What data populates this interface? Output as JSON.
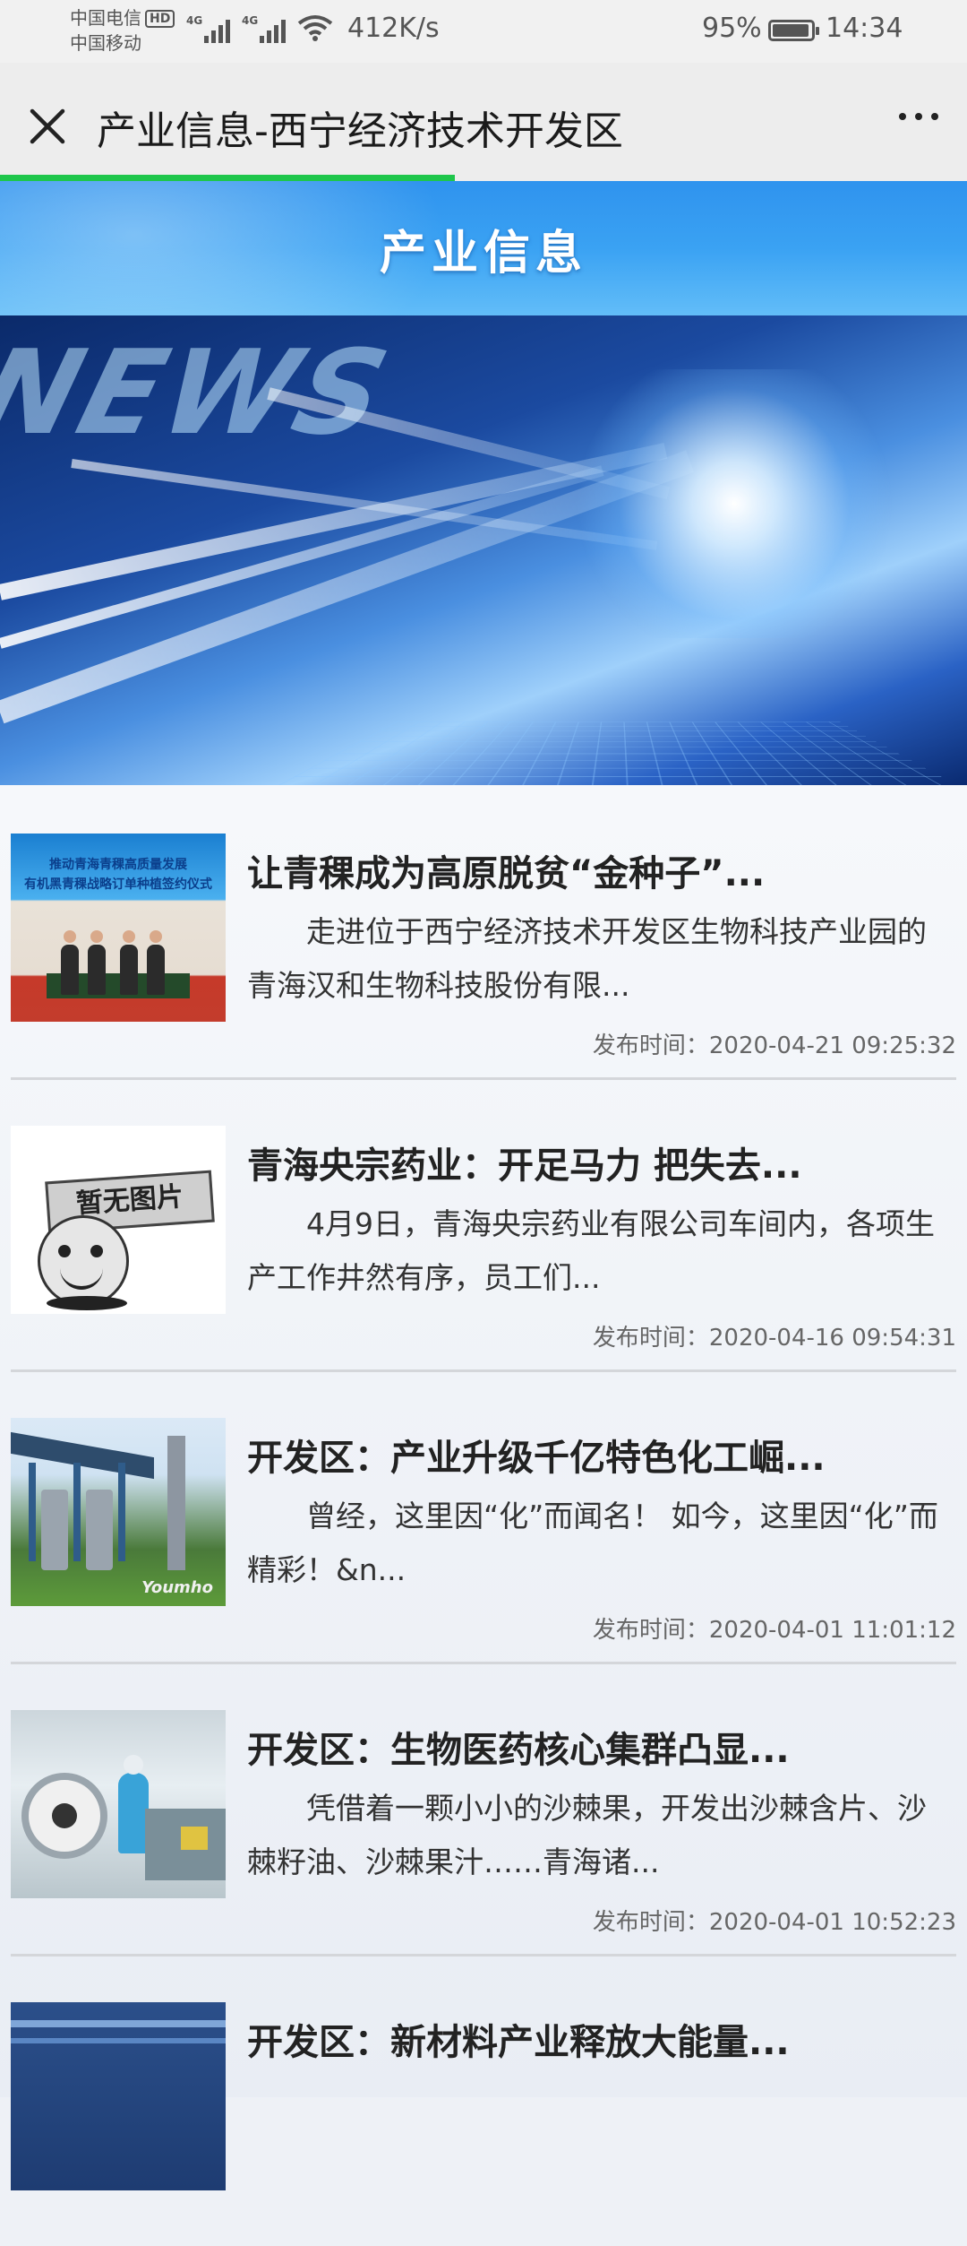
{
  "status_bar": {
    "carrier_1": "中国电信",
    "carrier_1_badge": "HD",
    "carrier_2": "中国移动",
    "network_1": "4G",
    "network_2": "4G",
    "speed": "412K/s",
    "battery_percent_text": "95%",
    "battery_level": 0.95,
    "time": "14:34"
  },
  "titlebar": {
    "close_icon": "close-icon",
    "title": "产业信息-西宁经济技术开发区",
    "more_icon": "more-icon",
    "load_progress": 0.47,
    "progress_color": "#1ec64b"
  },
  "banner": {
    "title": "产业信息",
    "hero_text": "NEWS"
  },
  "news": [
    {
      "title": "让青稞成为高原脱贫“金种子”...",
      "summary": "走进位于西宁经济技术开发区生物科技产业园的青海汉和生物科技股份有限...",
      "date_label": "发布时间：",
      "date": "2020-04-21 09:25:32",
      "thumb_text_1": "推动青海青稞高质量发展",
      "thumb_text_2": "有机黑青稞战略订单种植签约仪式"
    },
    {
      "title": "青海央宗药业：开足马力 把失去...",
      "summary": "4月9日，青海央宗药业有限公司车间内，各项生产工作井然有序，员工们...",
      "date_label": "发布时间：",
      "date": "2020-04-16 09:54:31",
      "thumb_text_1": "暂无图片"
    },
    {
      "title": "开发区：产业升级千亿特色化工崛...",
      "summary": "曾经，这里因“化”而闻名！ 如今，这里因“化”而精彩！&n...",
      "date_label": "发布时间：",
      "date": "2020-04-01 11:01:12",
      "thumb_text_1": "Youmho"
    },
    {
      "title": "开发区：生物医药核心集群凸显...",
      "summary": "凭借着一颗小小的沙棘果，开发出沙棘含片、沙棘籽油、沙棘果汁……青海诸...",
      "date_label": "发布时间：",
      "date": "2020-04-01 10:52:23"
    },
    {
      "title": "开发区：新材料产业释放大能量...",
      "summary": "",
      "date_label": "",
      "date": ""
    }
  ]
}
